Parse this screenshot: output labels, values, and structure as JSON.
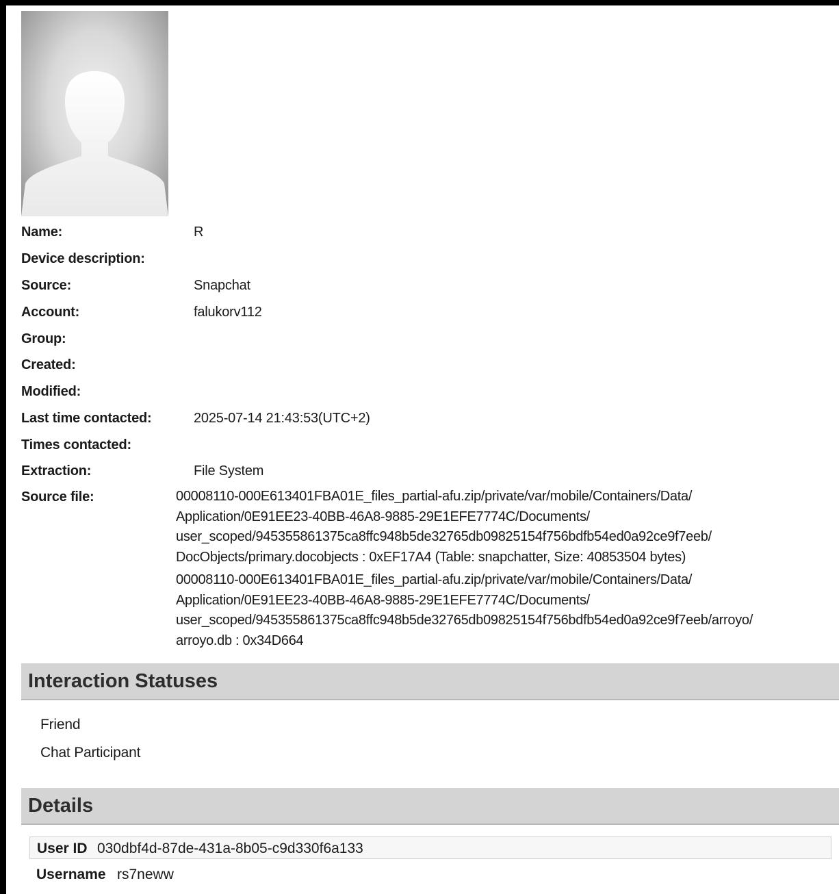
{
  "avatar": {
    "icon": "person-placeholder-icon"
  },
  "fields": [
    {
      "label": "Name:",
      "value": "R"
    },
    {
      "label": "Device description:",
      "value": ""
    },
    {
      "label": "Source:",
      "value": "Snapchat"
    },
    {
      "label": "Account:",
      "value": "falukorv112"
    },
    {
      "label": "Group:",
      "value": ""
    },
    {
      "label": "Created:",
      "value": ""
    },
    {
      "label": "Modified:",
      "value": ""
    },
    {
      "label": "Last time contacted:",
      "value": "2025-07-14 21:43:53(UTC+2)"
    },
    {
      "label": "Times contacted:",
      "value": ""
    },
    {
      "label": "Extraction:",
      "value": "File System"
    }
  ],
  "source_file": {
    "label": "Source file:",
    "lines": [
      "00008110-000E613401FBA01E_files_partial-afu.zip/private/var/mobile/Containers/Data/",
      "Application/0E91EE23-40BB-46A8-9885-29E1EFE7774C/Documents/",
      "user_scoped/945355861375ca8ffc948b5de32765db09825154f756bdfb54ed0a92ce9f7eeb/",
      "DocObjects/primary.docobjects : 0xEF17A4 (Table: snapchatter, Size: 40853504 bytes)",
      "00008110-000E613401FBA01E_files_partial-afu.zip/private/var/mobile/Containers/Data/",
      "Application/0E91EE23-40BB-46A8-9885-29E1EFE7774C/Documents/",
      "user_scoped/945355861375ca8ffc948b5de32765db09825154f756bdfb54ed0a92ce9f7eeb/arroyo/",
      "arroyo.db : 0x34D664"
    ]
  },
  "interaction_statuses": {
    "title": "Interaction Statuses",
    "items": [
      "Friend",
      "Chat Participant"
    ]
  },
  "details": {
    "title": "Details",
    "user_id": {
      "label": "User ID",
      "value": "030dbf4d-87de-431a-8b05-c9d330f6a133"
    },
    "username": {
      "label": "Username",
      "value": "rs7neww"
    }
  }
}
